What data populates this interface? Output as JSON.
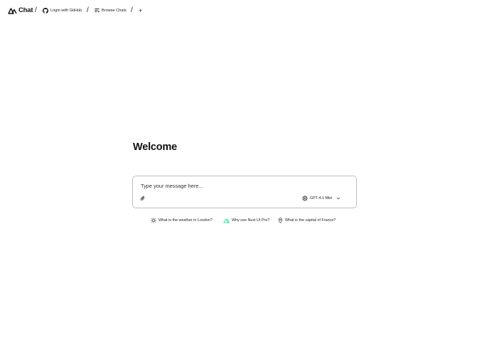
{
  "header": {
    "logo_text": "Chat",
    "separators": [
      "/",
      "/",
      "/"
    ],
    "login_label": "Login with GitHub",
    "browse_label": "Browse Chats",
    "new_chat_label": "+"
  },
  "main": {
    "welcome": "Welcome"
  },
  "composer": {
    "placeholder": "Type your message here...",
    "model_label": "GPT-4.1 Mini"
  },
  "suggestions": [
    {
      "label": "What is the weather in London?",
      "icon": "sun-icon"
    },
    {
      "label": "Why use Nuxt UI Pro?",
      "icon": "nuxt-icon"
    },
    {
      "label": "What is the capital of France?",
      "icon": "map-pin-icon"
    }
  ],
  "colors": {
    "text": "#111111",
    "border": "#bdbdbd",
    "nuxt_green": "#00dc82"
  }
}
